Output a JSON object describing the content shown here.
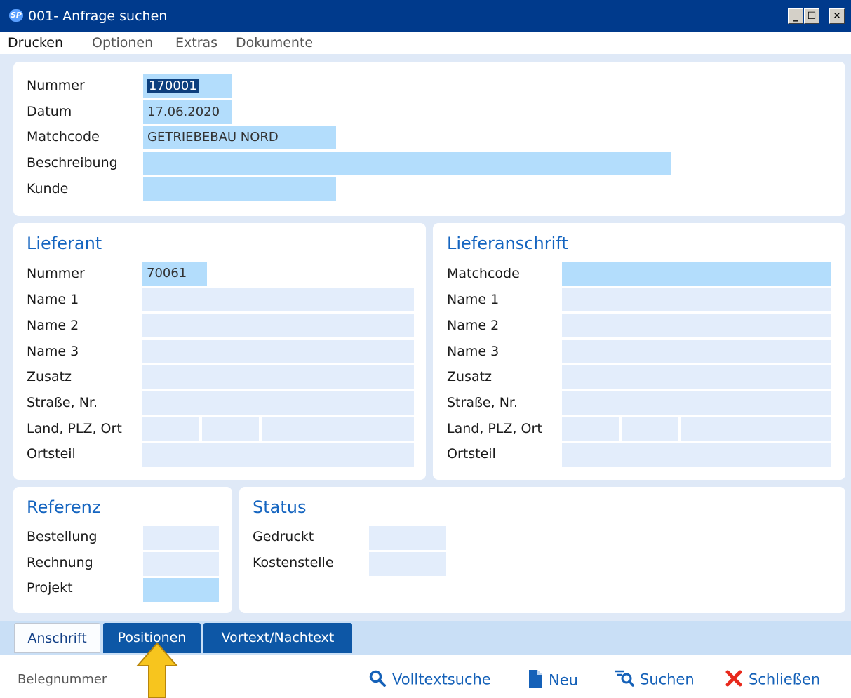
{
  "window": {
    "title": "001- Anfrage suchen",
    "app_icon": "sp-app-icon",
    "min": "_",
    "max": "☐",
    "close": "✕"
  },
  "menu": [
    "Drucken",
    "Optionen",
    "Extras",
    "Dokumente"
  ],
  "top_panel": {
    "nummer_label": "Nummer",
    "nummer_value": "170001",
    "datum_label": "Datum",
    "datum_value": "17.06.2020",
    "matchcode_label": "Matchcode",
    "matchcode_value": "GETRIEBEBAU NORD",
    "beschreibung_label": "Beschreibung",
    "beschreibung_value": "",
    "kunde_label": "Kunde",
    "kunde_value": ""
  },
  "lieferant": {
    "heading": "Lieferant",
    "nummer_label": "Nummer",
    "nummer_value": "70061",
    "name1_label": "Name 1",
    "name2_label": "Name 2",
    "name3_label": "Name 3",
    "zusatz_label": "Zusatz",
    "strasse_label": "Straße, Nr.",
    "land_label": "Land, PLZ, Ort",
    "ortsteil_label": "Ortsteil"
  },
  "lieferanschrift": {
    "heading": "Lieferanschrift",
    "matchcode_label": "Matchcode",
    "name1_label": "Name 1",
    "name2_label": "Name 2",
    "name3_label": "Name 3",
    "zusatz_label": "Zusatz",
    "strasse_label": "Straße, Nr.",
    "land_label": "Land, PLZ, Ort",
    "ortsteil_label": "Ortsteil"
  },
  "referenz": {
    "heading": "Referenz",
    "bestellung_label": "Bestellung",
    "rechnung_label": "Rechnung",
    "projekt_label": "Projekt"
  },
  "status": {
    "heading": "Status",
    "gedruckt_label": "Gedruckt",
    "kostenstelle_label": "Kostenstelle"
  },
  "tabs": [
    "Anschrift",
    "Positionen",
    "Vortext/Nachtext"
  ],
  "bottom": {
    "belegnummer": "Belegnummer",
    "volltextsuche": "Volltextsuche",
    "neu": "Neu",
    "suchen": "Suchen",
    "schliessen": "Schließen"
  },
  "colors": {
    "titlebar": "#003a8c",
    "accent": "#1565c0",
    "field": "#e3edfb",
    "field_highlight": "#b3ddfc",
    "tab_blue": "#0d57a6",
    "arrow": "#f7c51e"
  }
}
